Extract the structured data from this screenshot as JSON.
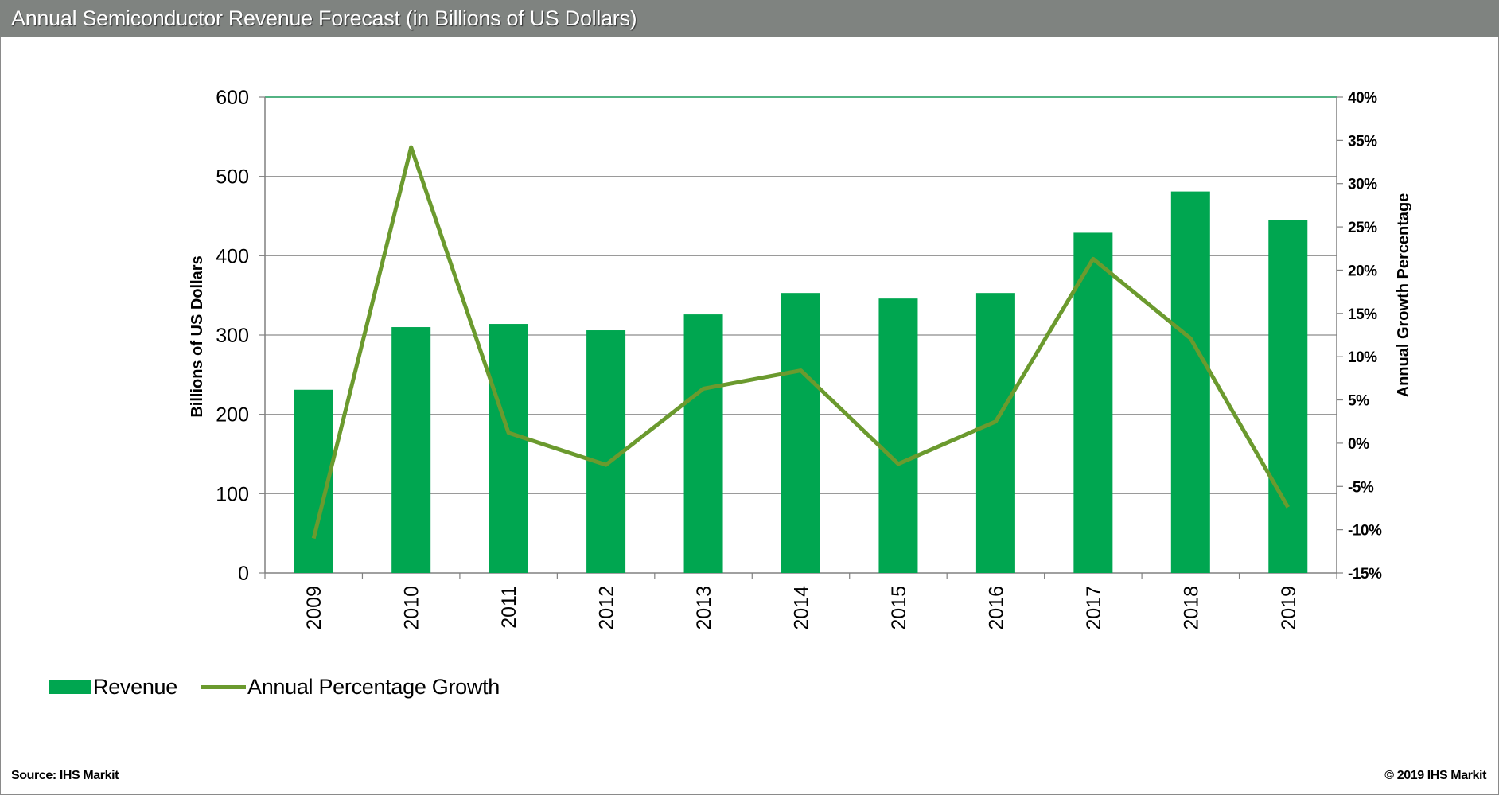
{
  "header": {
    "title": "Annual Semiconductor Revenue Forecast (in Billions of US Dollars)"
  },
  "footer": {
    "source": "Source: IHS Markit",
    "copyright": "© 2019 IHS Markit"
  },
  "colors": {
    "bar": "#00a650",
    "line": "#6b9a2e",
    "header_bg": "#7f8380",
    "grid": "#8c8c8c"
  },
  "chart_data": {
    "type": "bar",
    "categories": [
      "2009",
      "2010",
      "2011",
      "2012",
      "2013",
      "2014",
      "2015",
      "2016",
      "2017",
      "2018",
      "2019"
    ],
    "series": [
      {
        "name": "Revenue",
        "type": "bar",
        "axis": "left",
        "values": [
          231,
          310,
          314,
          306,
          326,
          353,
          346,
          353,
          429,
          481,
          445
        ]
      },
      {
        "name": "Annual Percentage Growth",
        "type": "line",
        "axis": "right",
        "values": [
          -11,
          34.2,
          1.2,
          -2.5,
          6.3,
          8.4,
          -2.4,
          2.5,
          21.3,
          12.1,
          -7.4
        ]
      }
    ],
    "ylabel": "Billions  of US Dollars",
    "y2label": "Annual Growth  Percentage",
    "ylim": [
      0,
      600
    ],
    "yticks": [
      "0",
      "100",
      "200",
      "300",
      "400",
      "500",
      "600"
    ],
    "y2lim": [
      -15,
      40
    ],
    "y2ticks": [
      "-15%",
      "-10%",
      "-5%",
      "0%",
      "5%",
      "10%",
      "15%",
      "20%",
      "25%",
      "30%",
      "35%",
      "40%"
    ],
    "grid": true,
    "legend_position": "bottom-left"
  }
}
